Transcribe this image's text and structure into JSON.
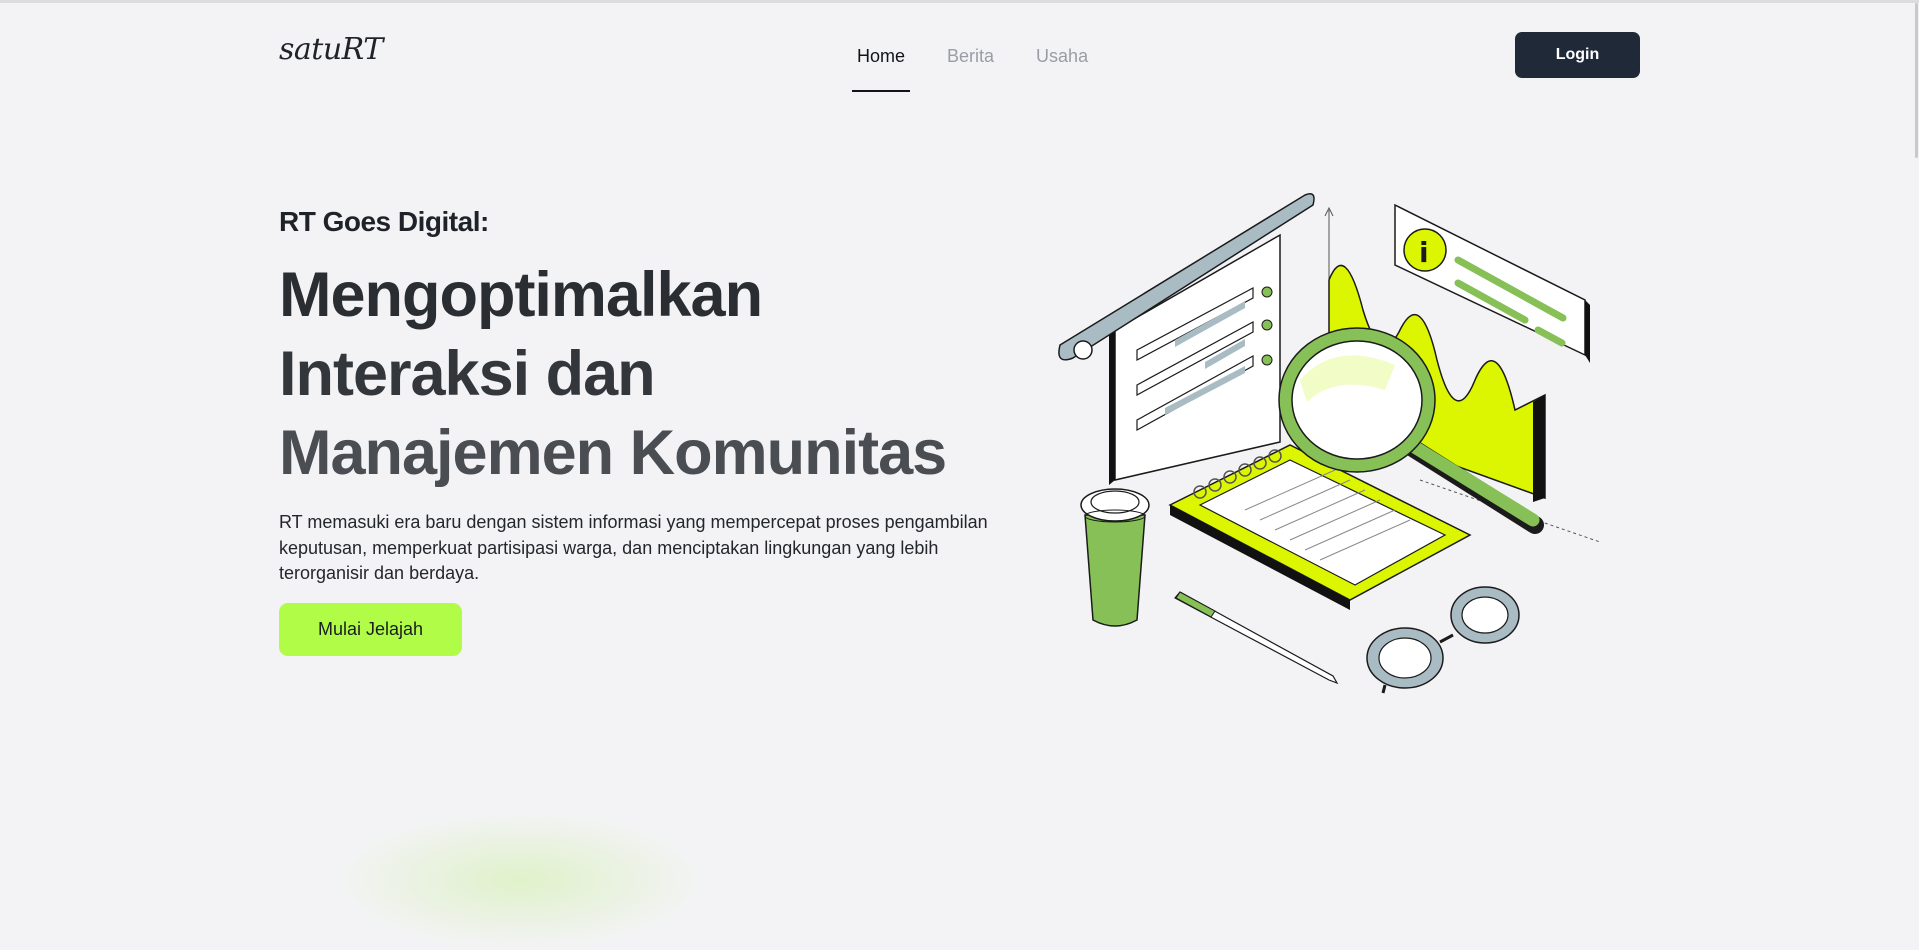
{
  "brand": {
    "logo_text": "satuRT"
  },
  "nav": {
    "items": [
      {
        "label": "Home",
        "active": true
      },
      {
        "label": "Berita",
        "active": false
      },
      {
        "label": "Usaha",
        "active": false
      }
    ]
  },
  "header": {
    "login_label": "Login"
  },
  "hero": {
    "eyebrow": "RT Goes Digital:",
    "headline_lines": [
      "Mengoptimalkan",
      "Interaksi dan",
      "Manajemen Komunitas"
    ],
    "description": "RT memasuki era baru dengan sistem informasi yang mempercepat proses pengambilan keputusan, memperkuat partisipasi warga, dan menciptakan lingkungan yang lebih terorganisir dan berdaya.",
    "cta_label": "Mulai Jelajah"
  },
  "colors": {
    "background": "#f3f3f5",
    "accent_lime": "#b0fc47",
    "dark_button": "#1f2937",
    "illustration_green": "#86c057",
    "illustration_yellow": "#dcf500"
  },
  "icons": [
    "data-analytics-illustration",
    "magnifier-icon",
    "info-icon",
    "coffee-cup-icon",
    "glasses-icon",
    "pen-icon",
    "notebook-icon"
  ]
}
